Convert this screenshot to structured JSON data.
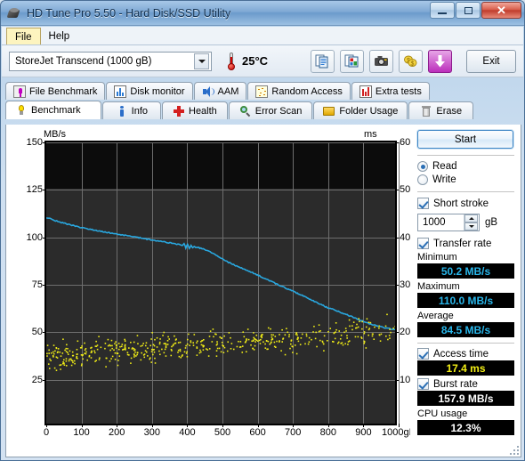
{
  "window": {
    "title": "HD Tune Pro 5.50 - Hard Disk/SSD Utility",
    "icon": "harddisk-icon",
    "minimize": "−",
    "maximize": "□",
    "close": "✕"
  },
  "menubar": {
    "items": [
      {
        "label": "File",
        "mnemonic": "F",
        "active": true
      },
      {
        "label": "Help",
        "mnemonic": "H",
        "active": false
      }
    ]
  },
  "toolbar": {
    "drive": {
      "value": "StoreJet Transcend (1000 gB)",
      "placeholder": "Select drive"
    },
    "temperature": "25°C",
    "buttons": [
      {
        "name": "copy-text-button",
        "icon": "copy-text-icon"
      },
      {
        "name": "copy-image-button",
        "icon": "copy-image-icon"
      },
      {
        "name": "screenshot-button",
        "icon": "camera-icon"
      },
      {
        "name": "donate-button",
        "icon": "money-icon"
      },
      {
        "name": "save-button",
        "icon": "download-arrow-icon"
      }
    ],
    "exit_label": "Exit"
  },
  "tabs": {
    "row1": [
      {
        "label": "File Benchmark",
        "icon": "file-benchmark-icon",
        "selected": false
      },
      {
        "label": "Disk monitor",
        "icon": "disk-monitor-icon",
        "selected": false
      },
      {
        "label": "AAM",
        "icon": "speaker-icon",
        "selected": false
      },
      {
        "label": "Random Access",
        "icon": "random-access-icon",
        "selected": false
      },
      {
        "label": "Extra tests",
        "icon": "extra-tests-icon",
        "selected": false
      }
    ],
    "row2": [
      {
        "label": "Benchmark",
        "icon": "benchmark-icon",
        "selected": true
      },
      {
        "label": "Info",
        "icon": "info-icon",
        "selected": false
      },
      {
        "label": "Health",
        "icon": "health-cross-icon",
        "selected": false
      },
      {
        "label": "Error Scan",
        "icon": "magnifier-icon",
        "selected": false
      },
      {
        "label": "Folder Usage",
        "icon": "folder-icon",
        "selected": false
      },
      {
        "label": "Erase",
        "icon": "trash-icon",
        "selected": false
      }
    ]
  },
  "panel": {
    "start_label": "Start",
    "mode": [
      {
        "label": "Read",
        "selected": true
      },
      {
        "label": "Write",
        "selected": false
      }
    ],
    "short_stroke": {
      "label": "Short stroke",
      "checked": true,
      "value": "1000",
      "unit": "gB"
    },
    "transfer_rate": {
      "label": "Transfer rate",
      "checked": true
    },
    "stats": [
      {
        "label": "Minimum",
        "value": "50.2 MB/s",
        "color": "#29b6ea"
      },
      {
        "label": "Maximum",
        "value": "110.0 MB/s",
        "color": "#29b6ea"
      },
      {
        "label": "Average",
        "value": "84.5 MB/s",
        "color": "#29b6ea"
      }
    ],
    "access_time": {
      "label": "Access time",
      "checked": true,
      "value": "17.4 ms",
      "color": "#f2ee16"
    },
    "burst_rate": {
      "label": "Burst rate",
      "checked": true,
      "value": "157.9 MB/s",
      "color": "#ffffff"
    },
    "cpu_usage": {
      "label": "CPU usage",
      "value": "12.3%",
      "color": "#ffffff"
    }
  },
  "chart_data": {
    "type": "line",
    "title": "",
    "xlabel": "gB",
    "ylabel": "MB/s",
    "y2label": "ms",
    "xlim": [
      0,
      1000
    ],
    "ylim": [
      0,
      150
    ],
    "y2lim": [
      0,
      60
    ],
    "grid": true,
    "legend": "none",
    "background": "#2b2b2b",
    "xticks": [
      0,
      100,
      200,
      300,
      400,
      500,
      600,
      700,
      800,
      900,
      1000
    ],
    "xtick_labels": [
      "0",
      "100",
      "200",
      "300",
      "400",
      "500",
      "600",
      "700",
      "800",
      "900",
      "1000gB"
    ],
    "yticks": [
      25,
      50,
      75,
      100,
      125,
      150
    ],
    "y2ticks": [
      10,
      20,
      30,
      40,
      50,
      60
    ],
    "series": [
      {
        "name": "Transfer rate",
        "type": "line",
        "axis": "left",
        "color": "#29a8e0",
        "unit": "MB/s",
        "x": [
          0,
          10,
          20,
          30,
          40,
          50,
          60,
          70,
          80,
          90,
          100,
          120,
          140,
          160,
          180,
          200,
          220,
          240,
          260,
          280,
          300,
          320,
          340,
          360,
          380,
          390,
          395,
          400,
          405,
          410,
          415,
          420,
          425,
          430,
          435,
          440,
          450,
          460,
          470,
          480,
          490,
          500,
          520,
          540,
          560,
          580,
          600,
          620,
          640,
          660,
          680,
          700,
          720,
          740,
          760,
          780,
          800,
          820,
          840,
          860,
          880,
          900,
          920,
          940,
          960,
          980,
          1000
        ],
        "y": [
          110.0,
          109.3,
          108.5,
          108.0,
          107.4,
          107.0,
          106.4,
          106.0,
          105.5,
          105.0,
          104.6,
          103.8,
          103.1,
          102.4,
          101.8,
          101.2,
          100.6,
          100.0,
          99.4,
          98.7,
          98.0,
          97.4,
          96.8,
          96.2,
          95.5,
          95.0,
          96.2,
          93.8,
          95.6,
          93.5,
          95.0,
          93.9,
          94.6,
          93.8,
          94.2,
          93.6,
          93.2,
          92.5,
          91.6,
          90.6,
          89.4,
          88.2,
          86.3,
          84.5,
          82.9,
          81.3,
          79.8,
          78.0,
          76.2,
          74.5,
          72.8,
          71.2,
          69.5,
          67.8,
          66.0,
          64.2,
          62.4,
          61.0,
          59.6,
          58.2,
          56.7,
          55.2,
          53.8,
          52.6,
          51.6,
          50.8,
          50.2
        ]
      },
      {
        "name": "Access time",
        "type": "scatter",
        "axis": "right",
        "color": "#f2ee16",
        "unit": "ms",
        "point_count": 640,
        "x_range": [
          0,
          1000
        ],
        "y_range": [
          8,
          30
        ],
        "y_mean_start": 14.5,
        "y_mean_end": 20.0,
        "y_spread": 4.2,
        "mean_value": 17.4
      }
    ]
  }
}
